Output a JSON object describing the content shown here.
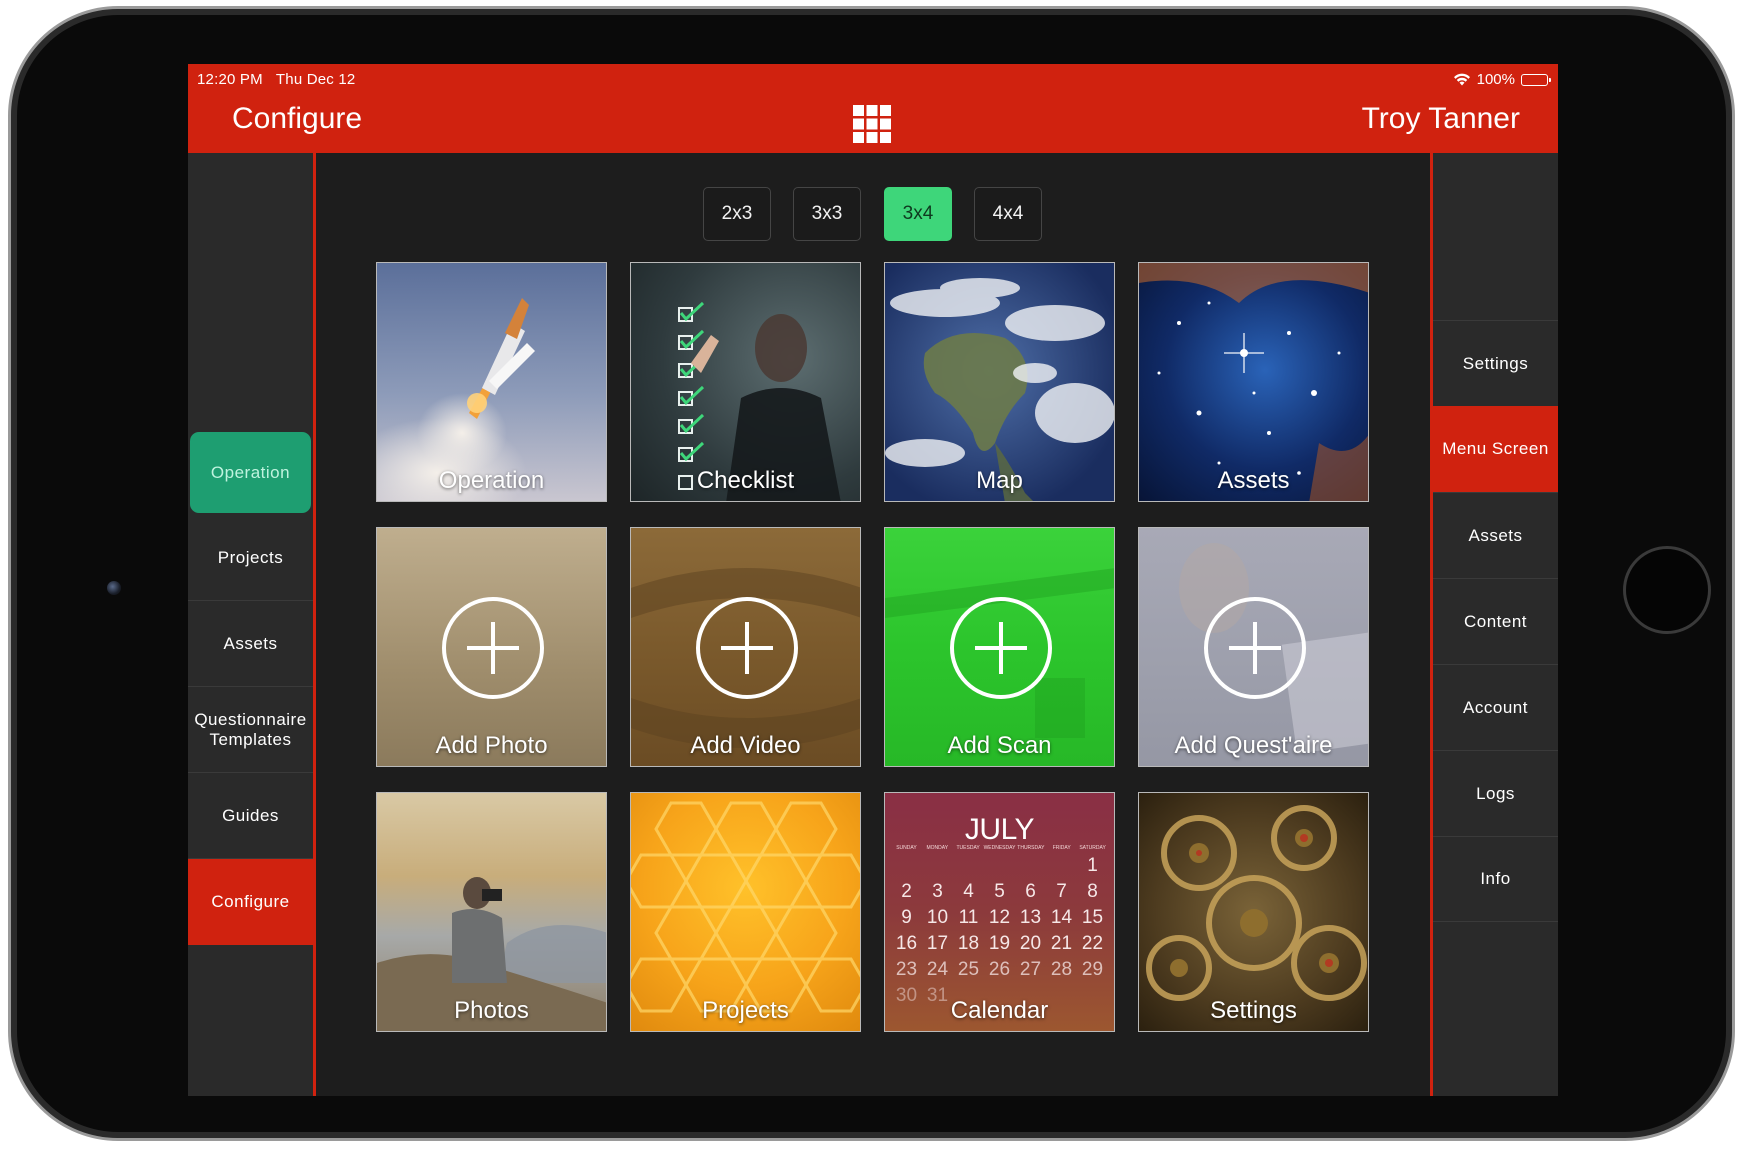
{
  "status_bar": {
    "time": "12:20 PM",
    "date": "Thu Dec 12",
    "battery": "100%"
  },
  "header": {
    "title": "Configure",
    "user": "Troy Tanner"
  },
  "layout_options": [
    {
      "label": "2x3",
      "selected": false
    },
    {
      "label": "3x3",
      "selected": false
    },
    {
      "label": "3x4",
      "selected": true
    },
    {
      "label": "4x4",
      "selected": false
    }
  ],
  "left_nav": {
    "items": [
      {
        "label": "Operation",
        "state": "highlighted"
      },
      {
        "label": "Projects"
      },
      {
        "label": "Assets"
      },
      {
        "label": "Questionnaire Templates"
      },
      {
        "label": "Guides"
      },
      {
        "label": "Configure",
        "state": "active"
      }
    ]
  },
  "right_nav": {
    "items": [
      {
        "label": "Settings"
      },
      {
        "label": "Menu Screen",
        "state": "active"
      },
      {
        "label": "Assets"
      },
      {
        "label": "Content"
      },
      {
        "label": "Account"
      },
      {
        "label": "Logs"
      },
      {
        "label": "Info"
      }
    ]
  },
  "tiles": [
    {
      "label": "Operation",
      "image": "rocket-launch"
    },
    {
      "label": "Checklist",
      "image": "checklist-person"
    },
    {
      "label": "Map",
      "image": "earth"
    },
    {
      "label": "Assets",
      "image": "starfield"
    },
    {
      "label": "Add Photo",
      "image": "plus-icon",
      "overlay_color": "#a08c6c"
    },
    {
      "label": "Add Video",
      "image": "plus-icon",
      "overlay_color": "#8a6530"
    },
    {
      "label": "Add Scan",
      "image": "plus-icon",
      "overlay_color": "#2fd12f"
    },
    {
      "label": "Add Quest'aire",
      "image": "plus-icon",
      "overlay_color": "#9d9fac"
    },
    {
      "label": "Photos",
      "image": "photographer"
    },
    {
      "label": "Projects",
      "image": "honeycomb"
    },
    {
      "label": "Calendar",
      "image": "calendar"
    },
    {
      "label": "Settings",
      "image": "gears"
    }
  ],
  "calendar": {
    "month": "JULY",
    "days": [
      "SUNDAY",
      "MONDAY",
      "TUESDAY",
      "WEDNESDAY",
      "THURSDAY",
      "FRIDAY",
      "SATURDAY"
    ],
    "weeks": [
      [
        "",
        "",
        "",
        "",
        "",
        "",
        "1"
      ],
      [
        "2",
        "3",
        "4",
        "5",
        "6",
        "7",
        "8"
      ],
      [
        "9",
        "10",
        "11",
        "12",
        "13",
        "14",
        "15"
      ],
      [
        "16",
        "17",
        "18",
        "19",
        "20",
        "21",
        "22"
      ],
      [
        "23",
        "24",
        "25",
        "26",
        "27",
        "28",
        "29"
      ],
      [
        "30",
        "31",
        "",
        "",
        "",
        "",
        ""
      ]
    ]
  },
  "colors": {
    "brand_red": "#d0220f",
    "active_green": "#1e9e71",
    "selected_layout": "#3ed67a"
  }
}
